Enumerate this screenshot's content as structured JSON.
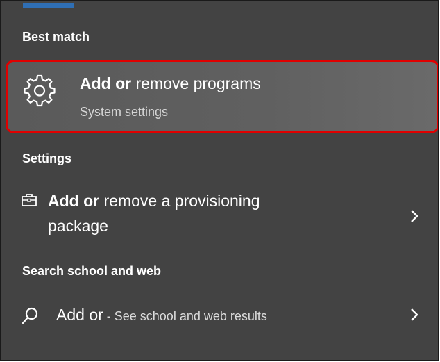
{
  "sections": {
    "best_match": "Best match",
    "settings": "Settings",
    "search_web": "Search school and web"
  },
  "best_match_result": {
    "title_bold": "Add or",
    "title_rest": " remove programs",
    "subtitle": "System settings",
    "icon": "gear-icon"
  },
  "settings_result": {
    "title_bold": "Add or",
    "title_rest": " remove a provisioning",
    "title_line2": "package",
    "icon": "briefcase-icon"
  },
  "web_result": {
    "query": "Add or",
    "hint": " - See school and web results",
    "icon": "search-icon"
  },
  "colors": {
    "panel_bg": "#434343",
    "highlight_border": "#e00000",
    "accent": "#2f6fb5"
  }
}
